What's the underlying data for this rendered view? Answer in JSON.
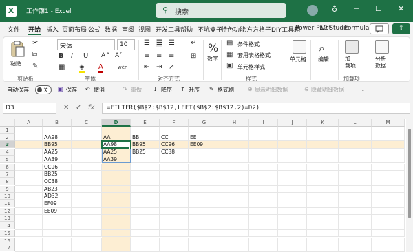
{
  "titlebar": {
    "logo_letter": "X",
    "title": "工作簿1 - Excel",
    "search_placeholder": "搜索",
    "minimize_glyph": "─",
    "maximize_glyph": "☐",
    "close_glyph": "✕",
    "accent": "#1e7145"
  },
  "tabs": [
    "文件",
    "开始",
    "插入",
    "页面布局",
    "公式",
    "数据",
    "审阅",
    "视图",
    "开发工具",
    "帮助",
    "不坑盒子",
    "特色功能",
    "方方格子",
    "DIY工具箱",
    "Power Pivot",
    "10 Studio",
    "Formula"
  ],
  "active_tab": "开始",
  "share_label": "⇧",
  "ribbon": {
    "clipboard": {
      "paste_label": "粘贴",
      "group_label": "剪贴板"
    },
    "font": {
      "font_name": "宋体",
      "font_size": "10",
      "bold": "B",
      "italic": "I",
      "underline": "U",
      "grow": "A^",
      "shrink": "Aˇ",
      "wen": "wén",
      "group_label": "字体"
    },
    "alignment": {
      "group_label": "对齐方式"
    },
    "number": {
      "percent": "%",
      "label": "数字"
    },
    "styles": {
      "conditional": "条件格式",
      "table": "套用表格格式",
      "cell_styles": "单元格样式",
      "group_label": "样式"
    },
    "cells": {
      "label": "单元格"
    },
    "editing": {
      "label": "编辑"
    },
    "addins": {
      "label": "加\n载项",
      "group_label": "加载项"
    },
    "analyze": {
      "label": "分析\n数据"
    }
  },
  "qat": {
    "autosave": "自动保存",
    "toggle_state": "关",
    "save": "保存",
    "undo": "撤消",
    "redo": "重做",
    "sort_desc": "降序",
    "sort_asc": "升序",
    "format_painter": "格式刷",
    "show_details": "显示明细数据",
    "hide_details": "隐藏明细数据"
  },
  "formula_bar": {
    "cell_ref": "D3",
    "cancel": "✕",
    "confirm": "✓",
    "fx": "fx",
    "formula": "=FILTER($B$2:$B$12,LEFT($B$2:$B$12,2)=D2)"
  },
  "grid": {
    "columns": [
      "A",
      "B",
      "C",
      "D",
      "E",
      "F",
      "G",
      "H",
      "I",
      "J",
      "K",
      "L",
      "M"
    ],
    "rows": [
      "1",
      "2",
      "3",
      "4",
      "5",
      "6",
      "7",
      "8",
      "9",
      "10",
      "11",
      "12",
      "13",
      "14",
      "15",
      "16",
      "17"
    ],
    "selected_col": "D",
    "selected_row": "3",
    "cells": [
      {
        "col": "B",
        "row": 2,
        "value": "AA98"
      },
      {
        "col": "B",
        "row": 3,
        "value": "BB95"
      },
      {
        "col": "B",
        "row": 4,
        "value": "AA25"
      },
      {
        "col": "B",
        "row": 5,
        "value": "AA39"
      },
      {
        "col": "B",
        "row": 6,
        "value": "CC96"
      },
      {
        "col": "B",
        "row": 7,
        "value": "BB25"
      },
      {
        "col": "B",
        "row": 8,
        "value": "CC38"
      },
      {
        "col": "B",
        "row": 9,
        "value": "AB23"
      },
      {
        "col": "B",
        "row": 10,
        "value": "AD32"
      },
      {
        "col": "B",
        "row": 11,
        "value": "EF09"
      },
      {
        "col": "B",
        "row": 12,
        "value": "EE09"
      },
      {
        "col": "D",
        "row": 2,
        "value": "AA"
      },
      {
        "col": "E",
        "row": 2,
        "value": "BB"
      },
      {
        "col": "F",
        "row": 2,
        "value": "CC"
      },
      {
        "col": "G",
        "row": 2,
        "value": "EE"
      },
      {
        "col": "D",
        "row": 3,
        "value": "AA98"
      },
      {
        "col": "E",
        "row": 3,
        "value": "BB95"
      },
      {
        "col": "F",
        "row": 3,
        "value": "CC96"
      },
      {
        "col": "G",
        "row": 3,
        "value": "EE09"
      },
      {
        "col": "D",
        "row": 4,
        "value": "AA25"
      },
      {
        "col": "E",
        "row": 4,
        "value": "BB25"
      },
      {
        "col": "F",
        "row": 4,
        "value": "CC38"
      },
      {
        "col": "D",
        "row": 5,
        "value": "AA39"
      }
    ]
  },
  "colors": {
    "accent": "#1e7145",
    "highlight": "#fdeed3",
    "spill_border": "#6b9bd1"
  }
}
